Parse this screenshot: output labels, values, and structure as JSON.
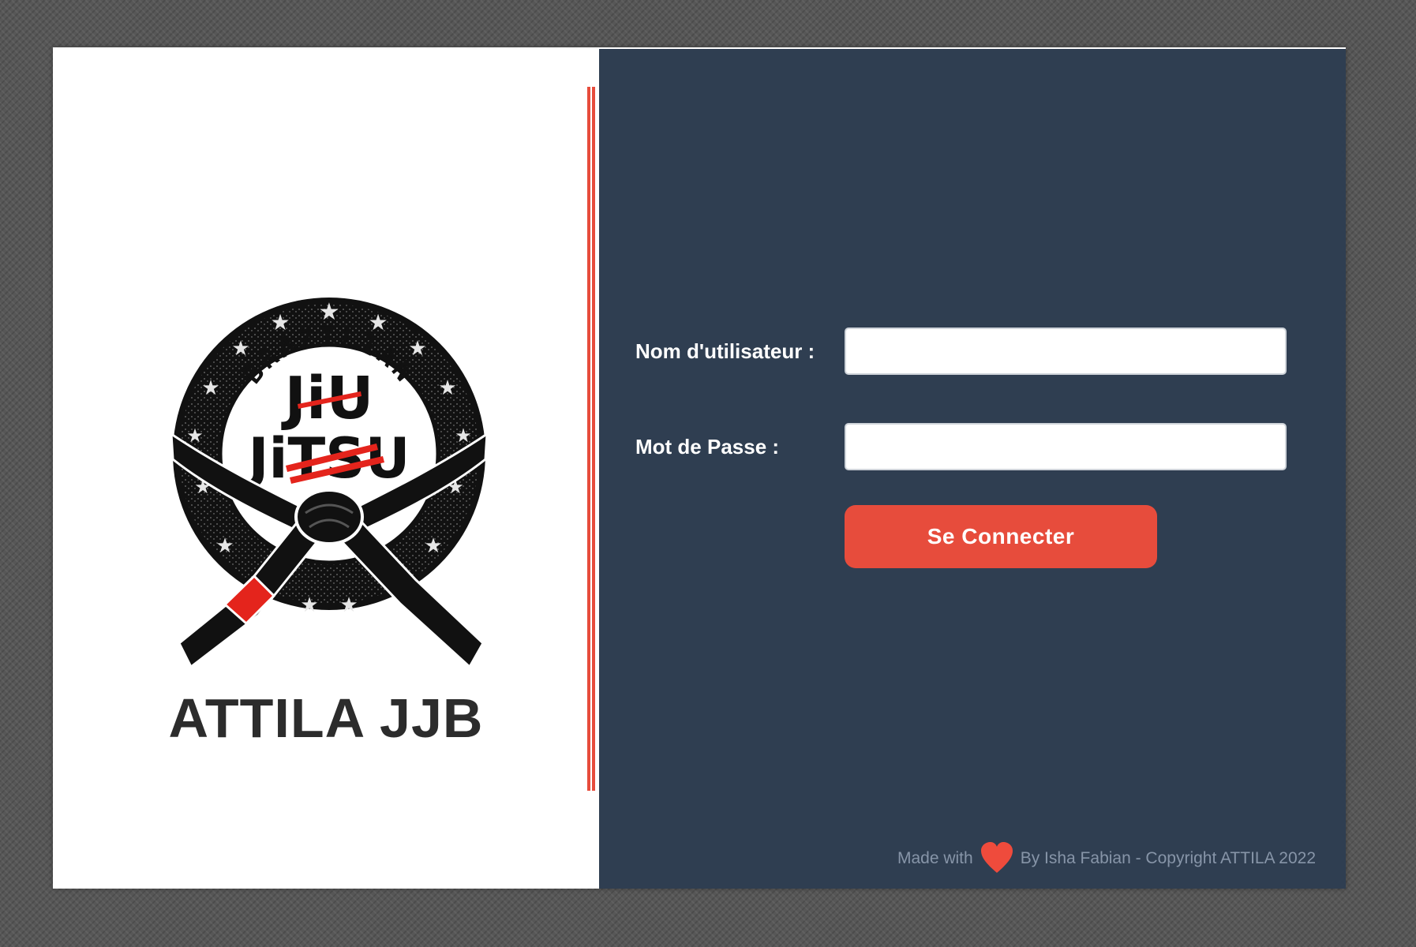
{
  "brand": {
    "name": "ATTILA JJB",
    "logo_text_top": "BRAZILIAN",
    "logo_text_mid": "JiU",
    "logo_text_bottom": "JiTSU"
  },
  "form": {
    "username_label": "Nom d'utilisateur :",
    "username_value": "",
    "password_label": "Mot de Passe :",
    "password_value": "",
    "submit_label": "Se Connecter"
  },
  "footer": {
    "made_with": "Made with",
    "heart_icon": "heart-icon",
    "credit": "By Isha Fabian - Copyright  ATTILA 2022"
  },
  "colors": {
    "accent": "#e74c3c",
    "panel": "#2f3e51",
    "footer_text": "#8795a8"
  }
}
